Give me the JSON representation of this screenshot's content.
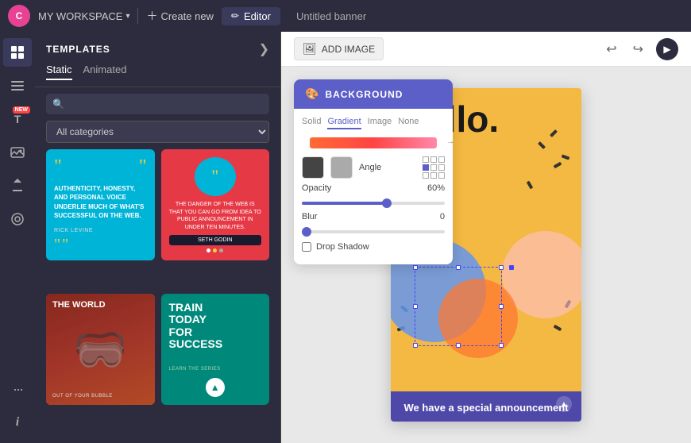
{
  "topbar": {
    "logo_text": "C",
    "workspace_label": "MY WORKSPACE",
    "create_label": "Create new",
    "editor_label": "Editor",
    "title": "Untitled banner"
  },
  "templates_panel": {
    "title": "TEMPLATES",
    "close_icon": "❯",
    "tabs": [
      {
        "label": "Static",
        "active": true
      },
      {
        "label": "Animated",
        "active": false
      }
    ],
    "search_placeholder": "",
    "category_default": "All categories",
    "add_image_label": "ADD IMAGE"
  },
  "background_panel": {
    "title": "BACKGROUND",
    "tabs": [
      "Solid",
      "Gradient",
      "Image",
      "None"
    ],
    "active_tab": "Gradient",
    "angle_label": "Angle",
    "opacity_label": "Opacity",
    "opacity_value": "60%",
    "blur_label": "Blur",
    "blur_value": "0",
    "drop_shadow_label": "Drop Shadow"
  },
  "toolbar": {
    "add_image_label": "ADD IMAGE",
    "undo_icon": "↩",
    "redo_icon": "↪"
  },
  "banner": {
    "hello_text": "hello.",
    "announcement_text": "We have a special announcement"
  },
  "template_cards": [
    {
      "id": "card1",
      "type": "blue_quote",
      "quote": "“”",
      "text": "AUTHENTICITY, HONESTY, AND PERSONAL VOICE UNDERLIE MUCH OF WHAT'S SUCCESSFUL ON THE WEB.",
      "author": "RICK LEVINE"
    },
    {
      "id": "card2",
      "type": "red_speech",
      "text": "THE DANGER OF THE WEB IS THAT YOU CAN GO FROM IDEA TO PUBLIC ANNOUNCEMENT IN UNDER TEN MINUTES.",
      "author": "SETH GODIN",
      "btn": "SETH GODIN"
    },
    {
      "id": "card3",
      "type": "world_vr",
      "text": "THE WORLD",
      "subtext": "OUT OF YOUR BUBBLE"
    },
    {
      "id": "card4",
      "type": "train",
      "title": "TRAIN TODAY FOR SUCCESS",
      "subtitle": "LEARN THE SERIES"
    }
  ],
  "iconbar": {
    "items": [
      {
        "icon": "⊞",
        "label": "templates",
        "active": true
      },
      {
        "icon": "☰",
        "label": "elements"
      },
      {
        "icon": "T",
        "label": "text",
        "badge": "NEW"
      },
      {
        "icon": "🖼",
        "label": "media"
      },
      {
        "icon": "↗",
        "label": "upload"
      },
      {
        "icon": "☺",
        "label": "brand"
      },
      {
        "icon": "···",
        "label": "more"
      },
      {
        "icon": "ℹ",
        "label": "info",
        "bottom": true
      }
    ]
  }
}
